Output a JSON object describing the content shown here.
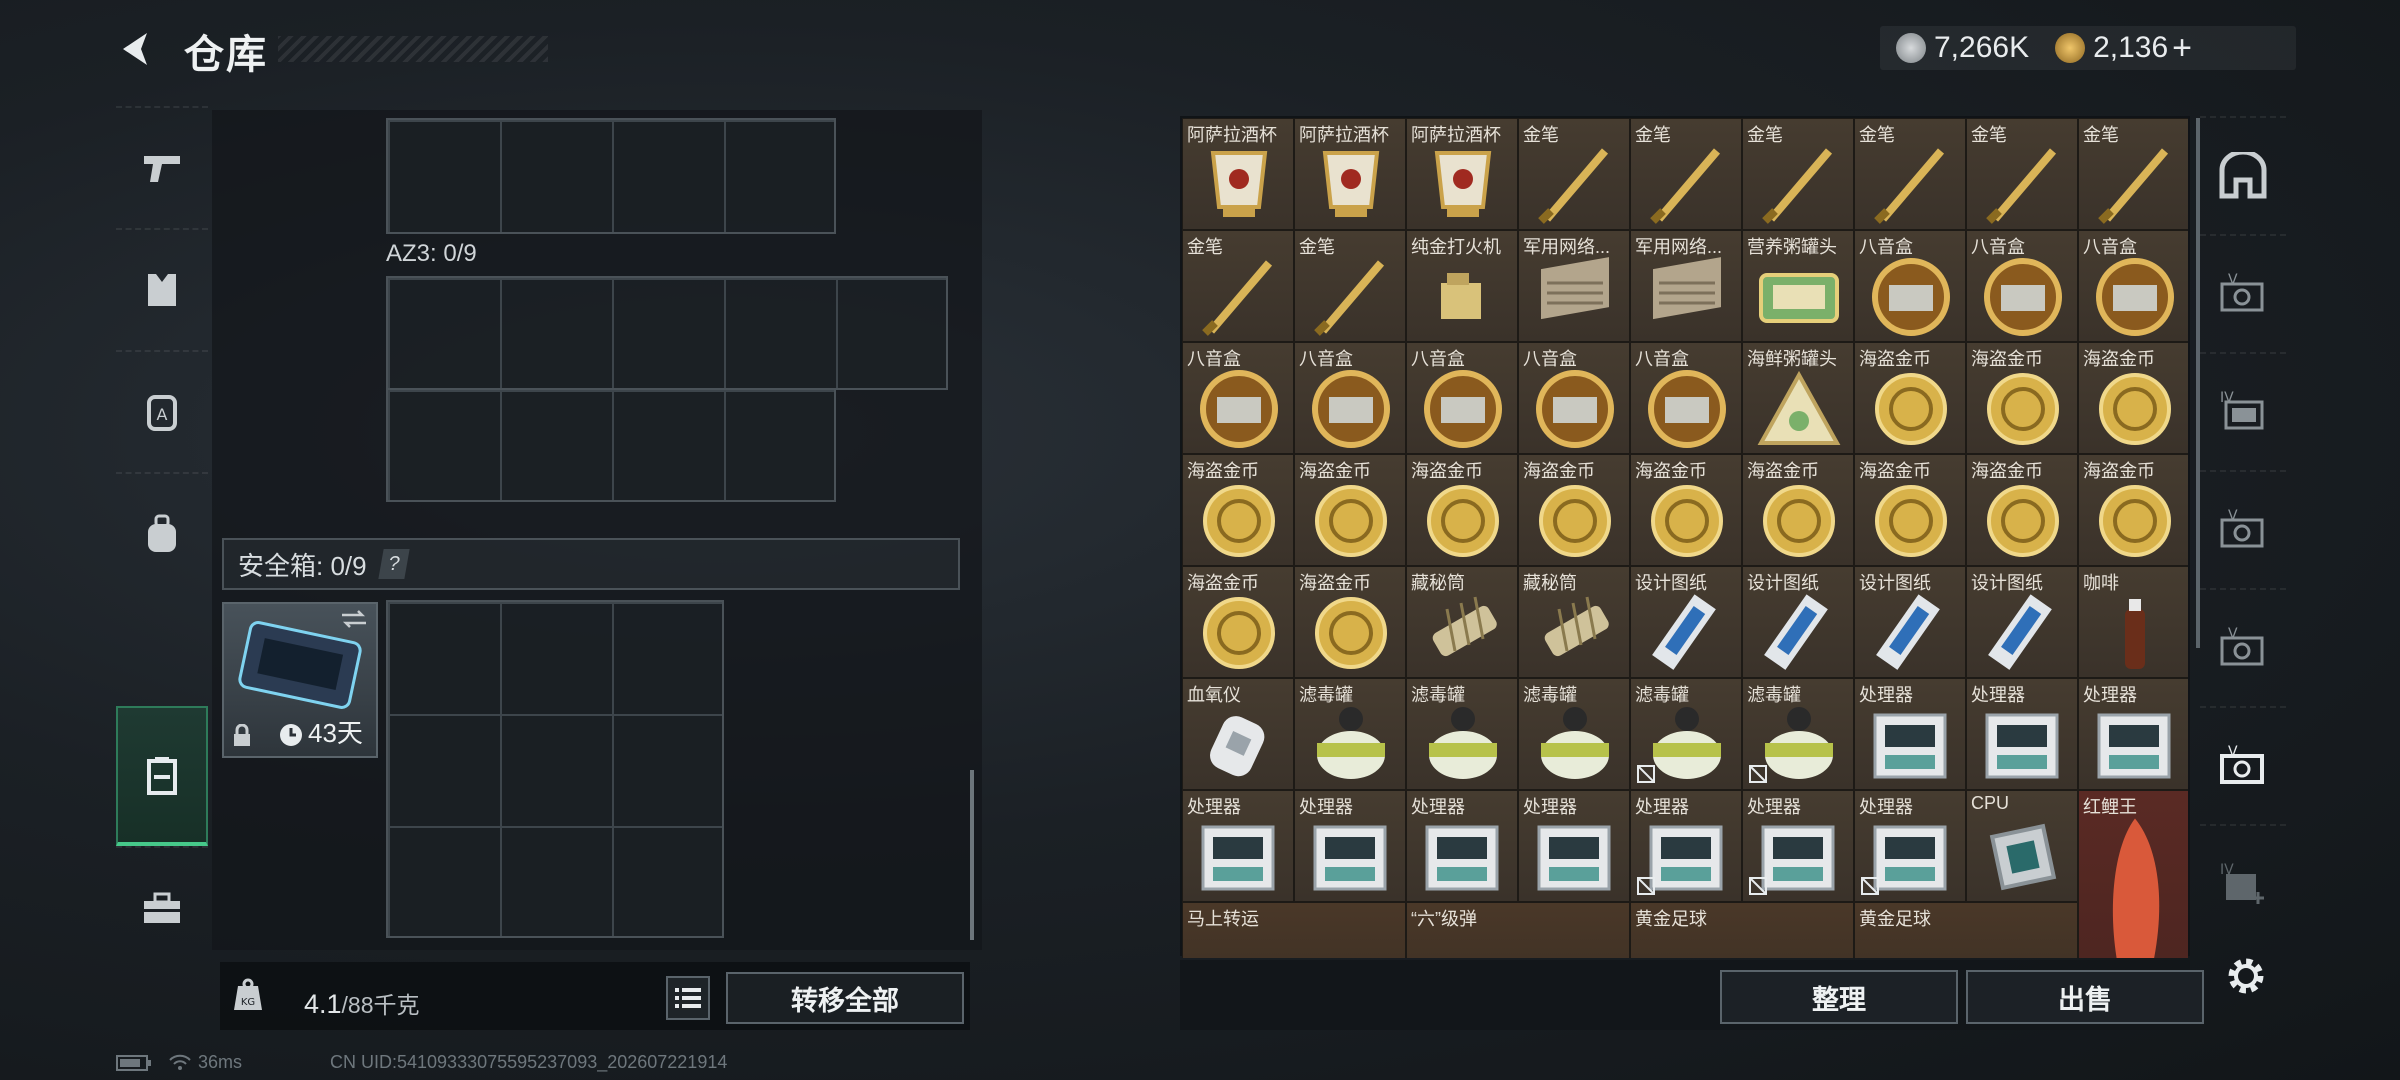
{
  "header": {
    "title": "仓库"
  },
  "currency": {
    "value1": "7,266K",
    "value2": "2,136",
    "plus": "+"
  },
  "left_nav": [
    "weapon",
    "armor-vest",
    "helmet",
    "backpack",
    "safe-box",
    "toolbox"
  ],
  "inventory": {
    "az3_label": "AZ3: 0/9",
    "safe_label": "安全箱: 0/9",
    "safe_help": "?",
    "case_days": "43天",
    "weight_current": "4.1",
    "weight_max": "/88千克",
    "transfer_all": "转移全部"
  },
  "stash": {
    "rows": [
      [
        "阿萨拉酒杯",
        "阿萨拉酒杯",
        "阿萨拉酒杯",
        "金笔",
        "金笔",
        "金笔",
        "金笔",
        "金笔",
        "金笔"
      ],
      [
        "金笔",
        "金笔",
        "纯金打火机",
        "军用网络...",
        "军用网络...",
        "营养粥罐头",
        "八音盒",
        "八音盒",
        "八音盒"
      ],
      [
        "八音盒",
        "八音盒",
        "八音盒",
        "八音盒",
        "八音盒",
        "海鲜粥罐头",
        "海盗金币",
        "海盗金币",
        "海盗金币"
      ],
      [
        "海盗金币",
        "海盗金币",
        "海盗金币",
        "海盗金币",
        "海盗金币",
        "海盗金币",
        "海盗金币",
        "海盗金币",
        "海盗金币"
      ],
      [
        "海盗金币",
        "海盗金币",
        "藏秘筒",
        "藏秘筒",
        "设计图纸",
        "设计图纸",
        "设计图纸",
        "设计图纸",
        "咖啡"
      ],
      [
        "血氧仪",
        "滤毒罐",
        "滤毒罐",
        "滤毒罐",
        "滤毒罐",
        "滤毒罐",
        "处理器",
        "处理器",
        "处理器"
      ],
      [
        "处理器",
        "处理器",
        "处理器",
        "处理器",
        "处理器",
        "处理器",
        "处理器",
        "CPU",
        "红鲤王"
      ],
      [
        "马上转运",
        "",
        "“六”级弹",
        "",
        "黄金足球",
        "",
        "黄金足球",
        "",
        ""
      ]
    ],
    "sort_label": "整理",
    "sell_label": "出售"
  },
  "footer": {
    "ping": "36ms",
    "uid": "CN UID:541093330755952370​93_202607221914"
  },
  "colors": {
    "accent": "#46c98a",
    "cell_bg": "#3f362c",
    "panel": "#151a1e"
  }
}
